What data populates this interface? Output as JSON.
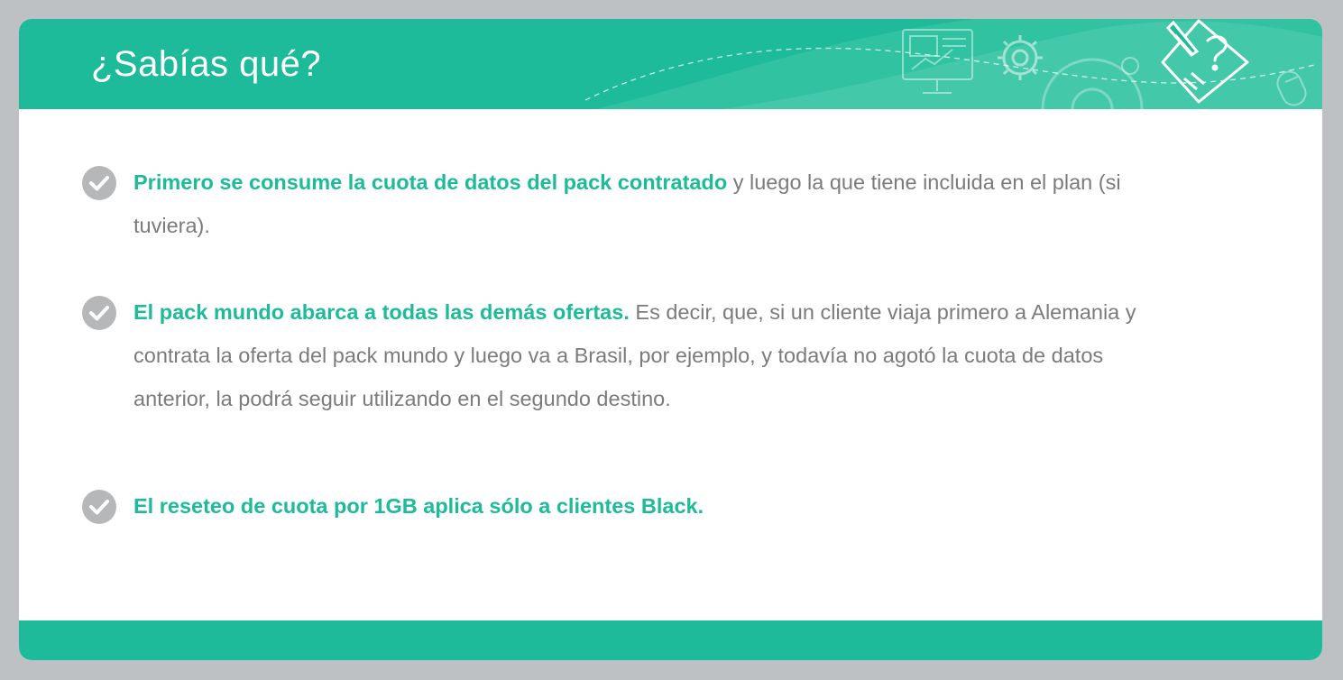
{
  "header": {
    "title": "¿Sabías qué?",
    "icons": [
      "presentation-board-icon",
      "gear-icon",
      "large-gear-icon",
      "lightbulb-icon",
      "document-pen-icon",
      "mouse-icon"
    ]
  },
  "items": [
    {
      "highlight": "Primero se consume la cuota de datos del pack contratado",
      "text": " y luego la que tiene incluida en el plan (si tuviera)."
    },
    {
      "highlight": "El pack mundo abarca a todas las demás ofertas.",
      "text": " Es decir, que, si un cliente viaja primero a Alemania y contrata la oferta del pack mundo y luego va a Brasil, por ejemplo, y todavía no agotó la cuota de datos anterior, la podrá seguir utilizando en el segundo destino."
    },
    {
      "highlight": "El reseteo de cuota por 1GB aplica sólo a clientes Black.",
      "text": ""
    }
  ],
  "colors": {
    "accent": "#1dbb99",
    "body_text": "#7b7b7b",
    "check_circle": "#b6b7b9",
    "background": "#bdc1c4"
  }
}
